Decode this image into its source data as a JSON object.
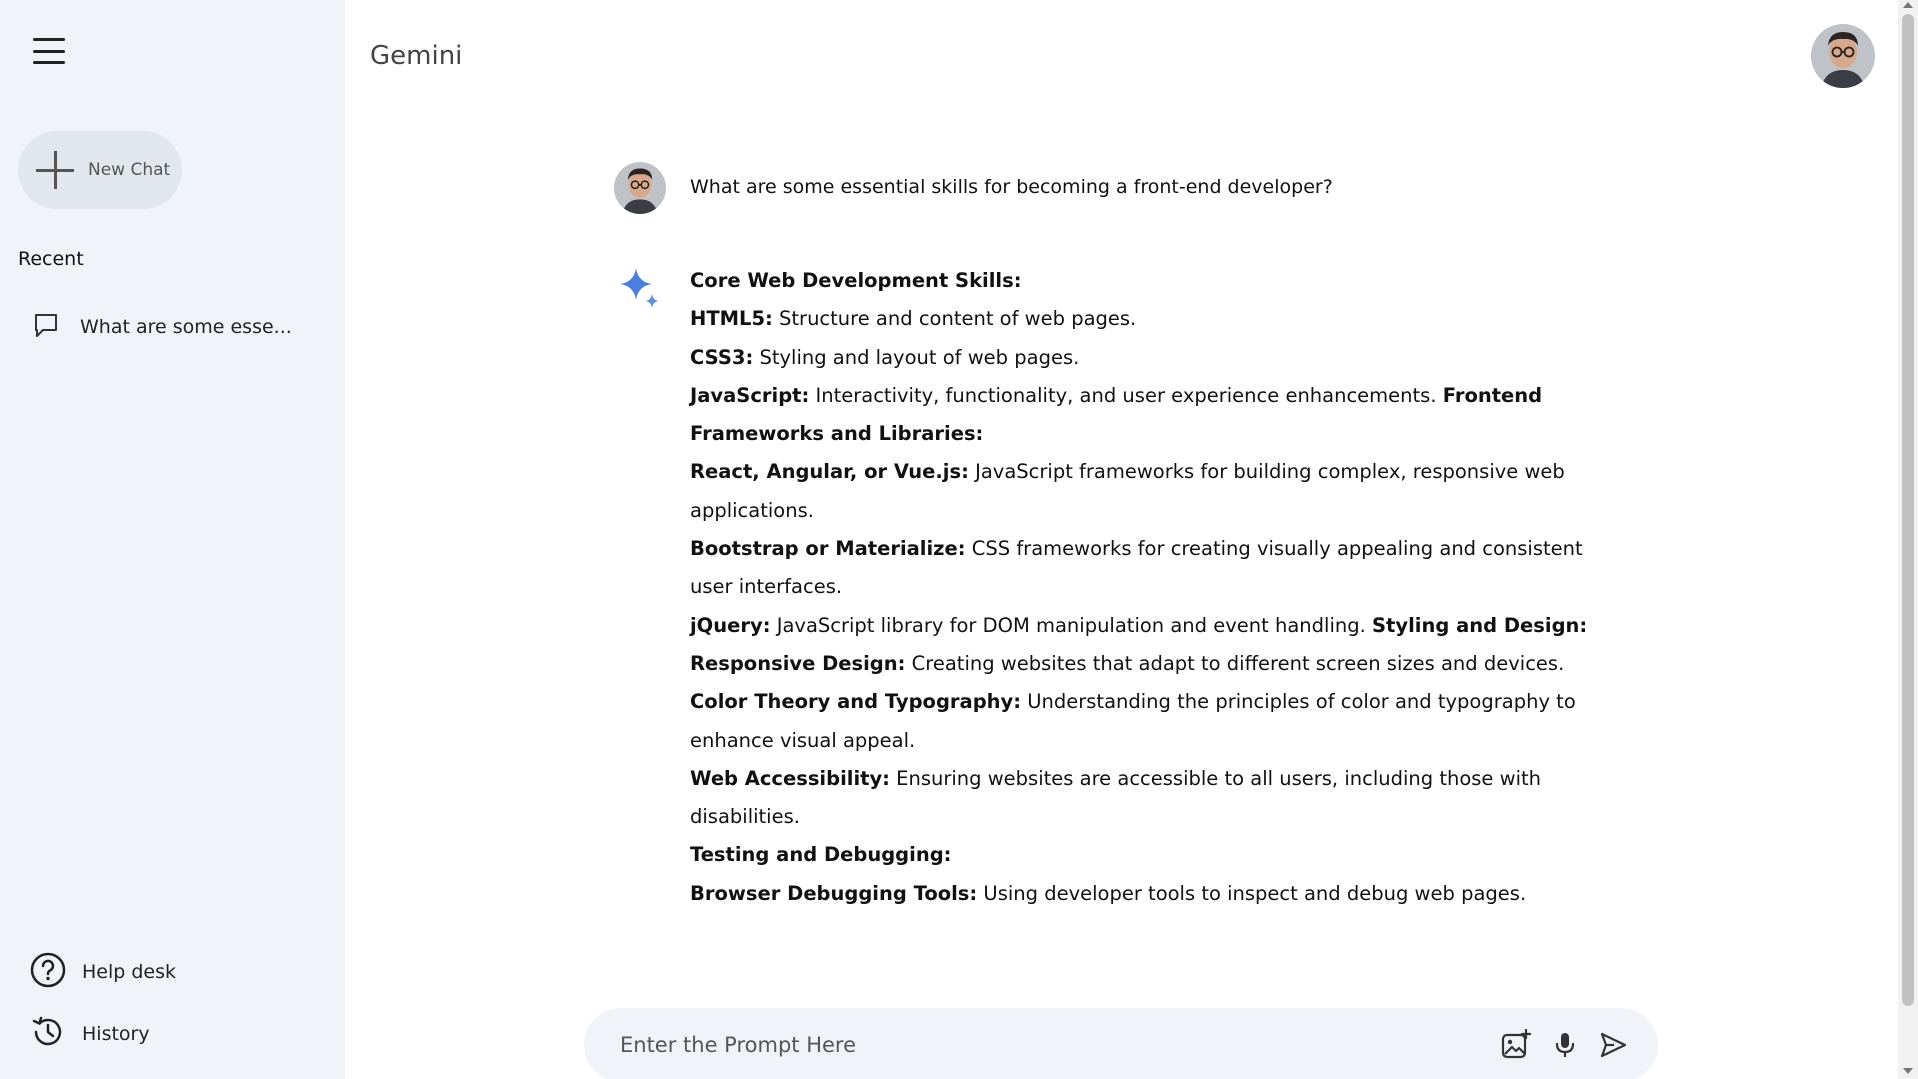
{
  "app": {
    "title": "Gemini"
  },
  "sidebar": {
    "new_chat_label": "New Chat",
    "recent_title": "Recent",
    "recent_items": [
      {
        "label": "What are some esse..."
      }
    ],
    "bottom_items": [
      {
        "label": "Help desk",
        "icon": "help-icon"
      },
      {
        "label": "History",
        "icon": "history-icon"
      }
    ]
  },
  "chat": {
    "user_message": "What are some essential skills for becoming a front-end developer?",
    "response": [
      {
        "bold": "Core Web Development Skills:",
        "text": ""
      },
      {
        "bold": "HTML5:",
        "text": " Structure and content of web pages."
      },
      {
        "bold": "CSS3:",
        "text": " Styling and layout of web pages."
      },
      {
        "bold": "JavaScript:",
        "text": " Interactivity, functionality, and user experience enhancements. ",
        "bold2": "Frontend Frameworks and Libraries:"
      },
      {
        "bold": "React, Angular, or Vue.js:",
        "text": " JavaScript frameworks for building complex, responsive web applications."
      },
      {
        "bold": "Bootstrap or Materialize:",
        "text": " CSS frameworks for creating visually appealing and consistent user interfaces."
      },
      {
        "bold": "jQuery:",
        "text": " JavaScript library for DOM manipulation and event handling. ",
        "bold2": "Styling and Design:"
      },
      {
        "bold": "Responsive Design:",
        "text": " Creating websites that adapt to different screen sizes and devices."
      },
      {
        "bold": "Color Theory and Typography:",
        "text": " Understanding the principles of color and typography to enhance visual appeal."
      },
      {
        "bold": "Web Accessibility:",
        "text": " Ensuring websites are accessible to all users, including those with disabilities."
      },
      {
        "bold": "Testing and Debugging:",
        "text": ""
      },
      {
        "bold": "Browser Debugging Tools:",
        "text": " Using developer tools to inspect and debug web pages."
      }
    ]
  },
  "prompt": {
    "placeholder": "Enter the Prompt Here",
    "value": ""
  },
  "colors": {
    "sidebar_bg": "#f0f4f9",
    "gemini_blue": "#4a7fe0",
    "prompt_bg": "#f0f4f9"
  }
}
